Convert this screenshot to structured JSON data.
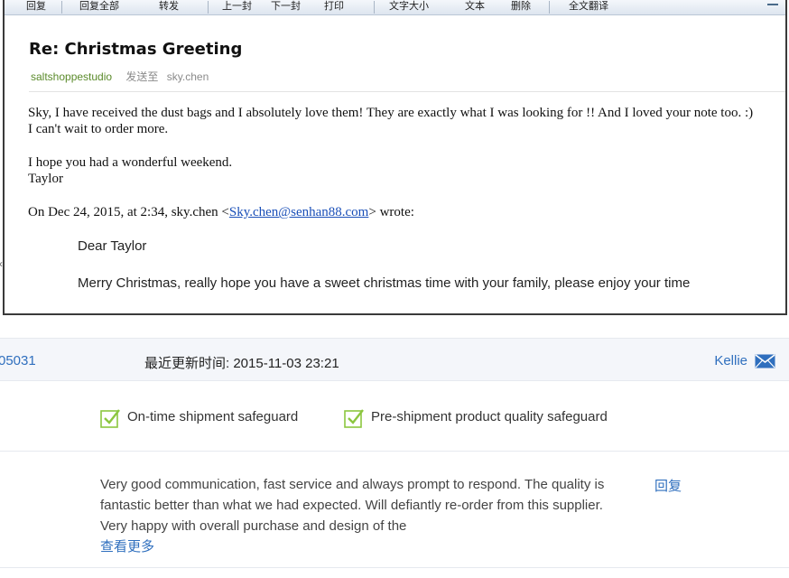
{
  "toolbar": {
    "reply": "回复",
    "reply_all": "回复全部",
    "forward": "转发",
    "prev": "上一封",
    "next": "下一封",
    "print": "打印",
    "text_size": "文字大小",
    "plain_text": "文本",
    "delete": "删除",
    "translate": "全文翻译"
  },
  "email": {
    "subject": "Re: Christmas Greeting",
    "sender": "saltshoppestudio",
    "sent_to_label": "发送至",
    "recipient": "sky.chen",
    "body_line1": "Sky, I have received the dust bags and I absolutely love them! They are exactly what I was looking for !! And I loved your note too. :)",
    "body_line2": "I can't wait to order more.",
    "body_line3": "I hope you had a wonderful weekend.",
    "body_line4": "Taylor",
    "quote_prefix": "On Dec 24, 2015, at 2:34, sky.chen <",
    "quote_email": "Sky.chen@senhan88.com",
    "quote_suffix": "> wrote:",
    "quoted_greeting": "Dear Taylor",
    "quoted_body": "Merry Christmas, really hope you have a sweet christmas time with your family, please enjoy your time"
  },
  "review": {
    "order_id_partial": "05031",
    "updated_label": "最近更新时间: ",
    "updated_time": "2015-11-03 23:21",
    "reviewer": "Kellie",
    "safeguard_1": "On-time shipment safeguard",
    "safeguard_2": "Pre-shipment product quality safeguard",
    "comment": "Very good communication, fast service and always prompt to respond. The quality is fantastic better than what we had expected. Will defiantly re-order from this supplier. Very happy with overall purchase and design of the",
    "see_more": "查看更多",
    "reply": "回复"
  },
  "icons": {
    "check": "check-box-icon",
    "mail": "mail-icon",
    "chevron": "chevron-left-icon"
  },
  "colors": {
    "link_blue": "#2f6fbe",
    "check_green": "#8cc63f",
    "sender_green": "#5a8a2a"
  }
}
